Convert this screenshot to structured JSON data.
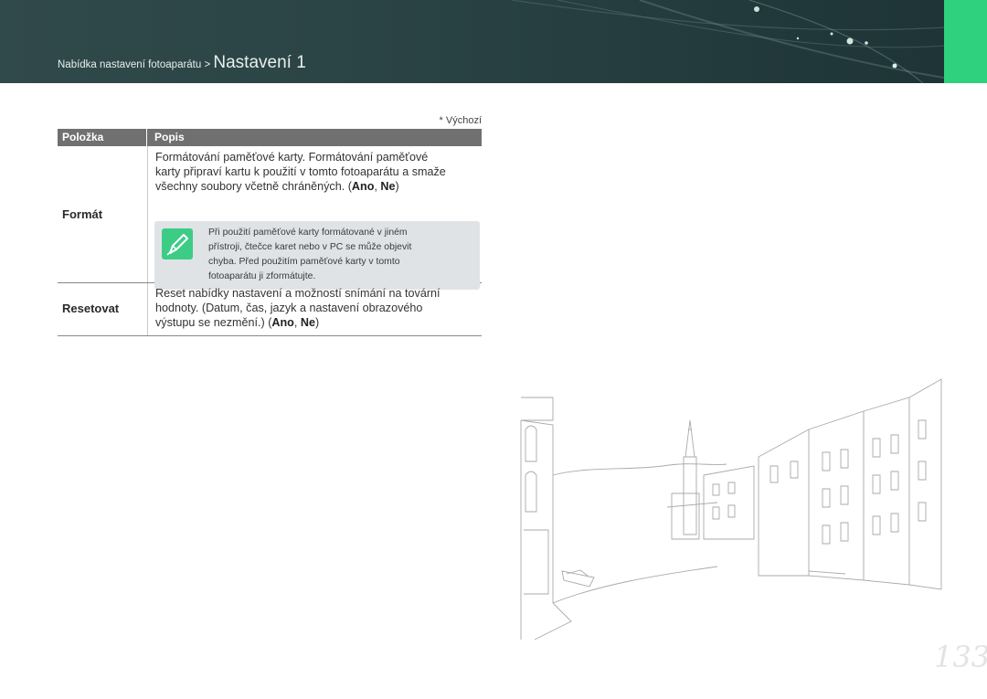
{
  "header": {
    "breadcrumb_small": "Nabídka nastavení fotoaparátu > ",
    "breadcrumb_big": "Nastavení 1"
  },
  "legend": "* Výchozí",
  "table": {
    "headers": [
      "Položka",
      "Popis"
    ],
    "rows": [
      {
        "item": "Formát",
        "description_lines": [
          "Formátování paměťové karty. Formátování paměťové",
          "karty připraví kartu k použití v tomto fotoaparátu a smaže"
        ],
        "description_last_prefix": "všechny soubory včetně chráněných. (",
        "options": [
          "Ano",
          "Ne"
        ],
        "note_lines": [
          "Při použití paměťové karty formátované v jiném",
          "přístroji, čtečce karet nebo v PC se může objevit",
          "chyba. Před použitím paměťové karty v tomto",
          "fotoaparátu ji zformátujte."
        ]
      },
      {
        "item": "Resetovat",
        "description_lines": [
          "Reset nabídky nastavení a možností snímání na tovární",
          "hodnoty. (Datum, čas, jazyk a nastavení obrazového"
        ],
        "description_last_prefix": "výstupu se nezmění.) (",
        "options": [
          "Ano",
          "Ne"
        ]
      }
    ]
  },
  "page_number": "133",
  "colors": {
    "header": "#2b4446",
    "accent_tab": "#2fd17e",
    "table_header": "#707070",
    "note_bg": "#dfe3e5",
    "note_icon": "#3ccc86"
  }
}
